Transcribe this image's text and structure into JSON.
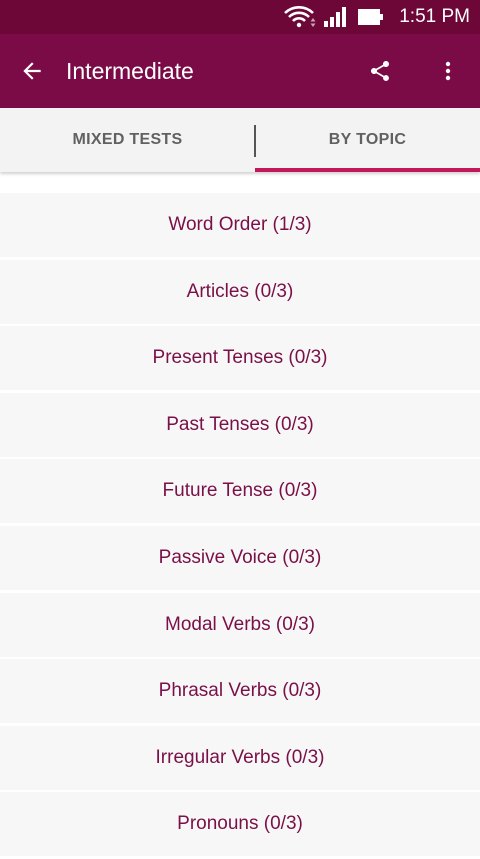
{
  "status_bar": {
    "time": "1:51 PM",
    "icons": [
      "wifi-icon",
      "signal-icon",
      "battery-icon"
    ]
  },
  "app_bar": {
    "title": "Intermediate",
    "icons": [
      "arrow-back-icon",
      "share-icon",
      "more-vert-icon"
    ]
  },
  "tabs": [
    {
      "label": "MIXED TESTS",
      "selected": false
    },
    {
      "label": "BY TOPIC",
      "selected": true
    }
  ],
  "topics": [
    "Word Order (1/3)",
    "Articles (0/3)",
    "Present Tenses (0/3)",
    "Past Tenses (0/3)",
    "Future Tense (0/3)",
    "Passive Voice (0/3)",
    "Modal Verbs (0/3)",
    "Phrasal Verbs (0/3)",
    "Irregular Verbs (0/3)",
    "Pronouns (0/3)"
  ],
  "colors": {
    "status_bar": "#6d0738",
    "app_bar": "#7b0b46",
    "accent": "#c2185b",
    "item_text": "#7a1048",
    "tab_text": "#616161",
    "item_bg": "#f7f7f7"
  }
}
